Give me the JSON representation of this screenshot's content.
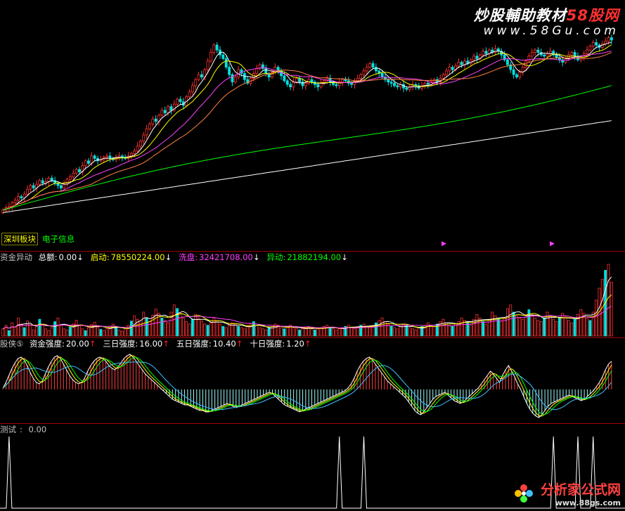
{
  "watermarks": {
    "top_main": "炒股輔助教材",
    "top_brand": "58股网",
    "top_url": "www.58Gu.com",
    "bottom_main": "分析家公式网",
    "bottom_url": "www.88gs.com"
  },
  "main_panel": {
    "tags": [
      "深圳板块",
      "电子信息"
    ],
    "colors": {
      "up": "#ff3030",
      "down": "#00e0e0",
      "ma5": "#ffffff",
      "ma10": "#ffff00",
      "ma20": "#ff40ff",
      "ma30": "#ff8040",
      "ma60": "#00ff00",
      "ma120": "#ffffff"
    }
  },
  "panel_fund": {
    "title": "资金异动",
    "items": [
      {
        "label": "总额:",
        "value": "0.00",
        "arrow": "↓",
        "color": "#ffffff"
      },
      {
        "label": "启动:",
        "value": "78550224.00",
        "arrow": "↓",
        "color": "#ffff00"
      },
      {
        "label": "洗盘:",
        "value": "32421708.00",
        "arrow": "↓",
        "color": "#ff40ff"
      },
      {
        "label": "异动:",
        "value": "21882194.00",
        "arrow": "↓",
        "color": "#00ff00"
      }
    ]
  },
  "panel_strength": {
    "title": "股侠⑤",
    "items": [
      {
        "label": "资金强度:",
        "value": "20.00",
        "arrow": "↑",
        "color": "#ffffff"
      },
      {
        "label": "三日强度:",
        "value": "16.00",
        "arrow": "↑",
        "color": "#ffffff"
      },
      {
        "label": "五日强度:",
        "value": "10.40",
        "arrow": "↑",
        "color": "#ffffff"
      },
      {
        "label": "十日强度:",
        "value": "1.20",
        "arrow": "↑",
        "color": "#ffffff"
      }
    ]
  },
  "panel_test": {
    "label": "测试",
    "value": "0.00"
  },
  "chart_data": [
    {
      "type": "candlestick",
      "bars": 200,
      "close": [
        10.2,
        10.4,
        10.5,
        10.8,
        11.0,
        11.3,
        11.2,
        11.5,
        11.9,
        12.2,
        12.0,
        12.3,
        12.6,
        12.4,
        12.5,
        12.8,
        12.6,
        12.4,
        12.2,
        12.0,
        12.3,
        12.7,
        12.9,
        13.2,
        13.5,
        13.3,
        13.8,
        14.2,
        14.0,
        14.6,
        14.4,
        14.2,
        14.3,
        14.5,
        14.6,
        14.4,
        14.3,
        14.5,
        14.6,
        14.5,
        14.4,
        14.6,
        14.8,
        15.0,
        15.4,
        15.8,
        16.3,
        16.8,
        17.2,
        17.6,
        17.4,
        17.9,
        18.3,
        18.1,
        18.6,
        18.3,
        18.8,
        19.2,
        19.0,
        18.7,
        19.4,
        19.8,
        20.3,
        20.8,
        21.2,
        21.0,
        21.6,
        22.3,
        23.0,
        23.6,
        23.2,
        22.8,
        22.5,
        21.8,
        21.2,
        20.6,
        21.0,
        21.6,
        21.3,
        20.8,
        20.5,
        20.9,
        21.3,
        21.7,
        22.0,
        21.7,
        21.3,
        21.0,
        21.4,
        21.8,
        21.5,
        21.1,
        20.7,
        20.4,
        20.2,
        20.6,
        20.9,
        20.6,
        20.3,
        20.5,
        20.8,
        20.6,
        20.4,
        20.2,
        20.5,
        20.7,
        20.9,
        20.6,
        20.4,
        20.3,
        20.6,
        20.8,
        20.7,
        20.5,
        20.4,
        20.7,
        20.9,
        21.2,
        21.5,
        21.8,
        22.1,
        21.8,
        21.5,
        21.3,
        21.0,
        20.8,
        20.6,
        20.5,
        20.3,
        20.2,
        20.4,
        20.1,
        20.0,
        20.2,
        20.4,
        20.3,
        20.1,
        20.3,
        20.5,
        20.4,
        20.6,
        20.8,
        20.6,
        20.9,
        21.2,
        21.5,
        21.8,
        21.6,
        21.9,
        22.2,
        22.0,
        22.3,
        22.1,
        22.4,
        22.7,
        22.5,
        22.8,
        23.1,
        22.9,
        23.2,
        23.0,
        23.3,
        23.1,
        22.8,
        22.4,
        22.0,
        21.6,
        21.2,
        21.0,
        21.4,
        21.8,
        22.3,
        22.7,
        23.0,
        23.2,
        23.0,
        22.8,
        22.7,
        22.9,
        23.1,
        22.8,
        22.6,
        22.4,
        22.2,
        22.5,
        22.8,
        23.0,
        22.7,
        22.4,
        22.6,
        22.9,
        23.2,
        23.5,
        23.8,
        23.6,
        23.4,
        23.7,
        23.9,
        24.2,
        24.0
      ],
      "ma_periods": [
        5,
        10,
        20,
        30,
        60,
        120
      ]
    },
    {
      "type": "bar",
      "name": "资金异动",
      "values": [
        12,
        18,
        9,
        22,
        15,
        30,
        20,
        14,
        25,
        18,
        10,
        16,
        28,
        20,
        12,
        9,
        14,
        24,
        30,
        18,
        12,
        10,
        15,
        20,
        26,
        17,
        12,
        9,
        14,
        19,
        23,
        15,
        11,
        9,
        12,
        16,
        20,
        14,
        10,
        8,
        12,
        18,
        25,
        34,
        28,
        22,
        40,
        30,
        24,
        35,
        45,
        38,
        30,
        26,
        22,
        40,
        52,
        46,
        38,
        30,
        24,
        20,
        28,
        36,
        30,
        25,
        20,
        18,
        22,
        30,
        26,
        20,
        16,
        14,
        18,
        22,
        20,
        16,
        14,
        12,
        16,
        20,
        24,
        18,
        14,
        12,
        10,
        14,
        16,
        20,
        18,
        14,
        12,
        16,
        18,
        14,
        12,
        10,
        12,
        14,
        16,
        12,
        10,
        12,
        14,
        16,
        18,
        14,
        12,
        10,
        12,
        14,
        16,
        18,
        14,
        12,
        16,
        18,
        20,
        16,
        14,
        18,
        22,
        26,
        30,
        24,
        20,
        16,
        14,
        12,
        16,
        20,
        18,
        14,
        12,
        10,
        14,
        16,
        18,
        22,
        18,
        16,
        20,
        24,
        28,
        22,
        18,
        16,
        20,
        24,
        30,
        26,
        22,
        18,
        28,
        36,
        30,
        24,
        20,
        28,
        40,
        34,
        28,
        24,
        30,
        46,
        52,
        40,
        34,
        30,
        28,
        36,
        44,
        36,
        30,
        26,
        24,
        30,
        40,
        34,
        28,
        24,
        30,
        38,
        32,
        26,
        22,
        28,
        36,
        44,
        38,
        30,
        26,
        40,
        60,
        80,
        95,
        110,
        120,
        90
      ],
      "ylim": [
        0,
        120
      ]
    },
    {
      "type": "bar",
      "name": "股侠⑤",
      "values": [
        2,
        10,
        20,
        30,
        38,
        44,
        46,
        42,
        34,
        24,
        16,
        10,
        8,
        12,
        22,
        32,
        40,
        46,
        48,
        44,
        36,
        28,
        20,
        14,
        10,
        8,
        10,
        16,
        26,
        34,
        40,
        44,
        46,
        44,
        40,
        34,
        30,
        28,
        32,
        38,
        44,
        48,
        50,
        46,
        40,
        34,
        28,
        22,
        18,
        14,
        10,
        6,
        2,
        -2,
        -6,
        -10,
        -14,
        -16,
        -18,
        -20,
        -22,
        -22,
        -24,
        -26,
        -28,
        -30,
        -30,
        -32,
        -32,
        -30,
        -28,
        -26,
        -24,
        -22,
        -20,
        -22,
        -24,
        -26,
        -24,
        -22,
        -20,
        -18,
        -16,
        -14,
        -12,
        -10,
        -8,
        -6,
        -4,
        -6,
        -10,
        -14,
        -18,
        -22,
        -24,
        -26,
        -28,
        -30,
        -32,
        -30,
        -28,
        -26,
        -24,
        -22,
        -20,
        -18,
        -16,
        -14,
        -12,
        -10,
        -8,
        -6,
        -4,
        -2,
        2,
        8,
        16,
        26,
        34,
        40,
        44,
        46,
        42,
        36,
        30,
        24,
        18,
        12,
        8,
        4,
        0,
        -4,
        -8,
        -12,
        -18,
        -24,
        -30,
        -34,
        -36,
        -32,
        -26,
        -20,
        -14,
        -10,
        -8,
        -6,
        -4,
        -8,
        -12,
        -16,
        -18,
        -20,
        -18,
        -14,
        -10,
        -6,
        -2,
        2,
        8,
        14,
        20,
        26,
        22,
        16,
        10,
        20,
        28,
        34,
        26,
        18,
        8,
        0,
        -10,
        -20,
        -28,
        -34,
        -38,
        -40,
        -36,
        -30,
        -24,
        -20,
        -18,
        -16,
        -14,
        -12,
        -10,
        -8,
        -10,
        -12,
        -14,
        -16,
        -14,
        -10,
        -6,
        -2,
        4,
        10,
        18,
        28,
        36,
        40
      ],
      "ylim": [
        -45,
        55
      ]
    },
    {
      "type": "spike",
      "name": "测试",
      "spikes_at": [
        2,
        110,
        118,
        180,
        188,
        193
      ],
      "ylim": [
        0,
        1
      ]
    }
  ]
}
